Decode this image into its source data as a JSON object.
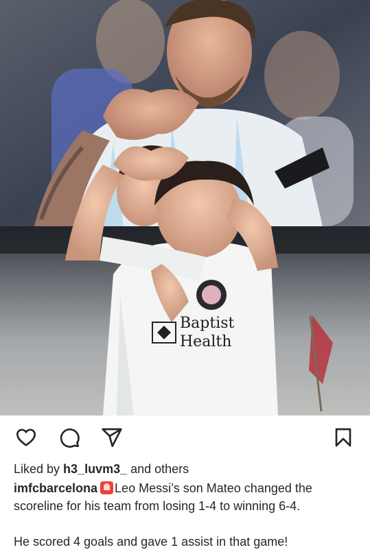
{
  "post": {
    "photo": {
      "alt": "",
      "jersey_text_line1": "Baptist",
      "jersey_text_line2": "Health"
    },
    "actions": {
      "like_icon": "heart-icon",
      "comment_icon": "comment-icon",
      "share_icon": "send-icon",
      "save_icon": "bookmark-icon"
    },
    "likes": {
      "prefix": "Liked by ",
      "user": "h3_luvm3_",
      "suffix": " and others"
    },
    "caption": {
      "username": "imfcbarcelona",
      "emoji": "police-light-emoji",
      "text": "Leo Messi’s son Mateo changed the scoreline for his team from losing 1-4 to winning 6-4.",
      "text_2": "He scored 4 goals and gave 1 assist in that game!"
    },
    "colors": {
      "text": "#262626",
      "background": "#ffffff",
      "emoji_red": "#e8443a"
    }
  }
}
